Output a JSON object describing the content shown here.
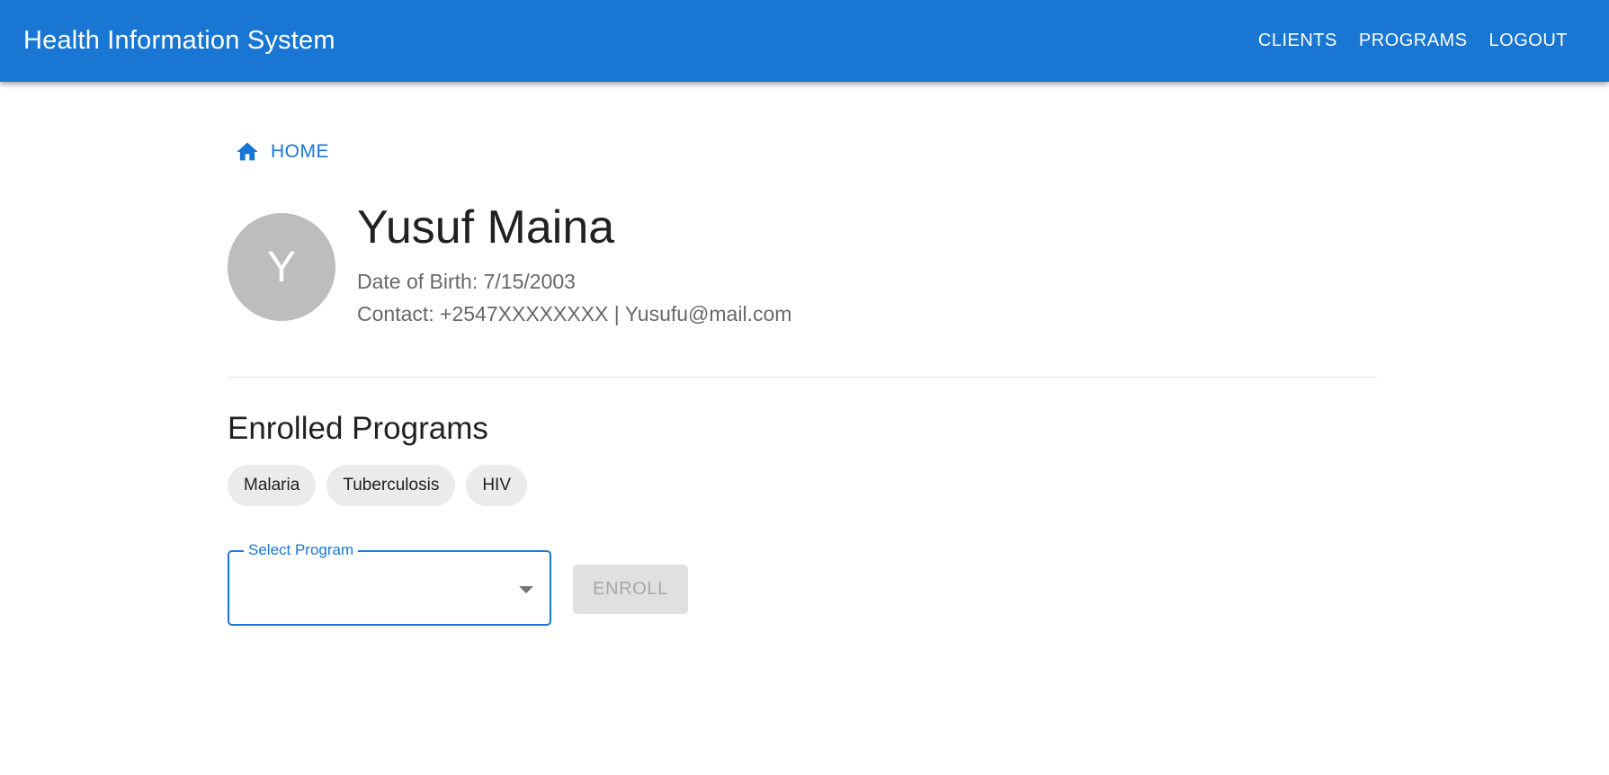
{
  "header": {
    "title": "Health Information System",
    "nav": [
      {
        "label": "CLIENTS"
      },
      {
        "label": "PROGRAMS"
      },
      {
        "label": "LOGOUT"
      }
    ]
  },
  "breadcrumb": {
    "label": "HOME",
    "icon": "home-icon"
  },
  "client": {
    "avatar_letter": "Y",
    "name": "Yusuf Maina",
    "dob_text": "Date of Birth: 7/15/2003",
    "contact_text": "Contact: +2547XXXXXXXX | Yusufu@mail.com"
  },
  "enrolled": {
    "title": "Enrolled Programs",
    "programs": [
      "Malaria",
      "Tuberculosis",
      "HIV"
    ]
  },
  "enroll_form": {
    "select_label": "Select Program",
    "select_value": "",
    "button_label": "ENROLL",
    "button_disabled": true
  },
  "colors": {
    "primary": "#1976d2",
    "avatar_bg": "#bdbdbd",
    "chip_bg": "#ebebeb"
  }
}
